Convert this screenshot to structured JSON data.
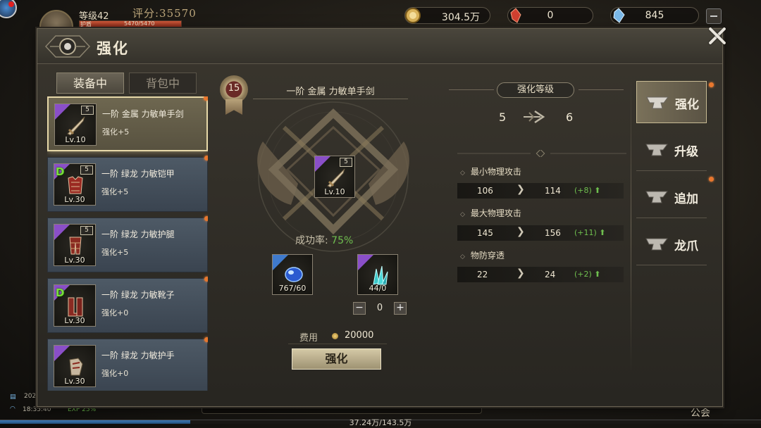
{
  "hud": {
    "level": "等级42",
    "score": "评分:35570",
    "hp_label": "护盾",
    "hp": "5470/5470",
    "gold": "304.5万",
    "gem_red": "0",
    "gem_blue": "845"
  },
  "bottom": {
    "year": "202",
    "time": "18:35:40",
    "exp": "EXP 25%",
    "exp_fraction": 0.25,
    "hp_total": "37.24万/143.5万",
    "guild": "公会"
  },
  "panel": {
    "title": "强化",
    "tabs": [
      "装备中",
      "背包中"
    ]
  },
  "items": [
    {
      "name": "一阶 金属 力敏单手剑",
      "enhance": "强化+5",
      "level": "Lv.10",
      "tier": "5",
      "grade": "purple",
      "d_badge": ""
    },
    {
      "name": "一阶 绿龙 力敏铠甲",
      "enhance": "强化+5",
      "level": "Lv.30",
      "tier": "5",
      "grade": "purple",
      "d_badge": "D"
    },
    {
      "name": "一阶 绿龙 力敏护腿",
      "enhance": "强化+5",
      "level": "Lv.30",
      "tier": "5",
      "grade": "purple",
      "d_badge": ""
    },
    {
      "name": "一阶 绿龙 力敏靴子",
      "enhance": "强化+0",
      "level": "Lv.30",
      "tier": "",
      "grade": "purple",
      "d_badge": "D"
    },
    {
      "name": "一阶 绿龙 力敏护手",
      "enhance": "强化+0",
      "level": "Lv.30",
      "tier": "",
      "grade": "purple",
      "d_badge": ""
    }
  ],
  "center": {
    "medal_level": "15",
    "weapon_title": "一阶 金属 力敏单手剑",
    "weapon_tier": "5",
    "weapon_level": "Lv.10",
    "success_label": "成功率:",
    "success_rate": "75%",
    "mat1_count": "767/60",
    "mat2_count": "44/0",
    "stepper_minus": "−",
    "stepper_value": "0",
    "stepper_plus": "+",
    "cost_label": "费用",
    "cost_value": "20000",
    "enhance_button": "强化"
  },
  "stats": {
    "header": "强化等级",
    "level_from": "5",
    "level_to": "6",
    "arrow": "❯",
    "rows": [
      {
        "name": "最小物理攻击",
        "from": "106",
        "to": "114",
        "delta": "(+8) ⬆"
      },
      {
        "name": "最大物理攻击",
        "from": "145",
        "to": "156",
        "delta": "(+11) ⬆"
      },
      {
        "name": "物防穿透",
        "from": "22",
        "to": "24",
        "delta": "(+2) ⬆"
      }
    ]
  },
  "side_menu": [
    "强化",
    "升级",
    "追加",
    "龙爪"
  ],
  "colors": {
    "accent_green": "#6fbf4f",
    "notify_orange": "#e8772e",
    "grade_purple": "#8a4fc8"
  }
}
